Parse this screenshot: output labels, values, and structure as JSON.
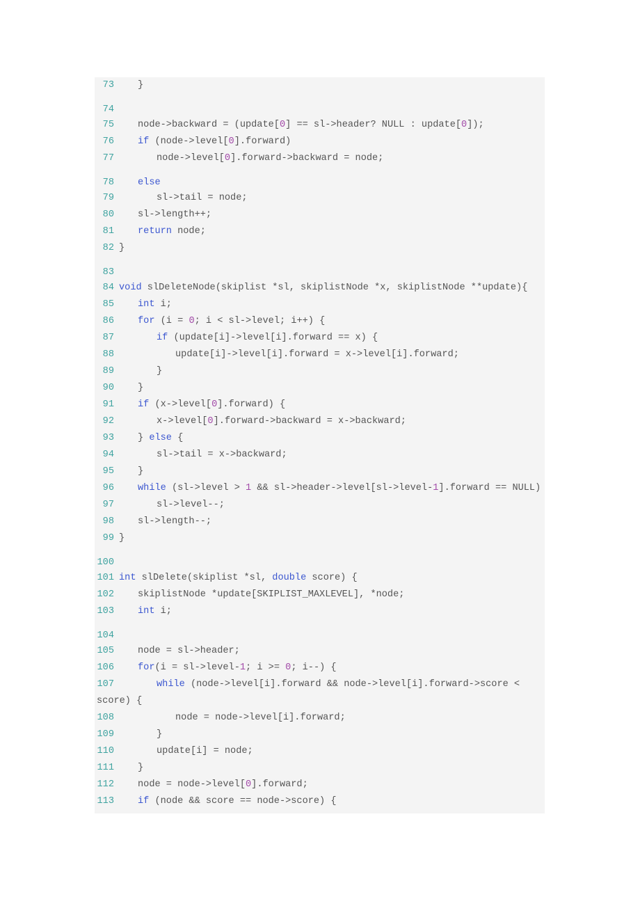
{
  "code_lines": [
    {
      "n": "73",
      "indent": 1,
      "seg": [
        [
          "p",
          "}"
        ]
      ]
    },
    {
      "n": "74",
      "indent": 0,
      "seg": []
    },
    {
      "n": "75",
      "indent": 1,
      "seg": [
        [
          "p",
          "node->backward = (update["
        ],
        [
          "n",
          "0"
        ],
        [
          "p",
          "] == sl->header? NULL : update["
        ],
        [
          "n",
          "0"
        ],
        [
          "p",
          "]);"
        ]
      ]
    },
    {
      "n": "76",
      "indent": 1,
      "seg": [
        [
          "k",
          "if"
        ],
        [
          "p",
          " (node->level["
        ],
        [
          "n",
          "0"
        ],
        [
          "p",
          "].forward)"
        ]
      ]
    },
    {
      "n": "77",
      "indent": 2,
      "seg": [
        [
          "p",
          "node->level["
        ],
        [
          "n",
          "0"
        ],
        [
          "p",
          "].forward->backward = node;"
        ]
      ]
    },
    {
      "n": "78",
      "indent": 1,
      "seg": [
        [
          "k",
          "else"
        ]
      ]
    },
    {
      "n": "79",
      "indent": 2,
      "seg": [
        [
          "p",
          "sl->tail = node;"
        ]
      ]
    },
    {
      "n": "80",
      "indent": 1,
      "seg": [
        [
          "p",
          "sl->length++;"
        ]
      ]
    },
    {
      "n": "81",
      "indent": 1,
      "seg": [
        [
          "k",
          "return"
        ],
        [
          "p",
          " node;"
        ]
      ]
    },
    {
      "n": "82",
      "indent": 0,
      "seg": [
        [
          "p",
          "}"
        ]
      ]
    },
    {
      "n": "83",
      "indent": 0,
      "seg": []
    },
    {
      "n": "84",
      "indent": 0,
      "seg": [
        [
          "k",
          "void"
        ],
        [
          "p",
          " slDeleteNode(skiplist *sl, skiplistNode *x, skiplistNode **update){"
        ]
      ]
    },
    {
      "n": "85",
      "indent": 1,
      "seg": [
        [
          "k",
          "int"
        ],
        [
          "p",
          " i;"
        ]
      ]
    },
    {
      "n": "86",
      "indent": 1,
      "seg": [
        [
          "k",
          "for"
        ],
        [
          "p",
          " (i = "
        ],
        [
          "n",
          "0"
        ],
        [
          "p",
          "; i < sl->level; i++) {"
        ]
      ]
    },
    {
      "n": "87",
      "indent": 2,
      "seg": [
        [
          "k",
          "if"
        ],
        [
          "p",
          " (update[i]->level[i].forward == x) {"
        ]
      ]
    },
    {
      "n": "88",
      "indent": 3,
      "seg": [
        [
          "p",
          "update[i]->level[i].forward = x->level[i].forward;"
        ]
      ]
    },
    {
      "n": "89",
      "indent": 2,
      "seg": [
        [
          "p",
          "}"
        ]
      ]
    },
    {
      "n": "90",
      "indent": 1,
      "seg": [
        [
          "p",
          "}"
        ]
      ]
    },
    {
      "n": "91",
      "indent": 1,
      "seg": [
        [
          "k",
          "if"
        ],
        [
          "p",
          " (x->level["
        ],
        [
          "n",
          "0"
        ],
        [
          "p",
          "].forward) {"
        ]
      ]
    },
    {
      "n": "92",
      "indent": 2,
      "seg": [
        [
          "p",
          "x->level["
        ],
        [
          "n",
          "0"
        ],
        [
          "p",
          "].forward->backward = x->backward;"
        ]
      ]
    },
    {
      "n": "93",
      "indent": 1,
      "seg": [
        [
          "p",
          "} "
        ],
        [
          "k",
          "else"
        ],
        [
          "p",
          " {"
        ]
      ]
    },
    {
      "n": "94",
      "indent": 2,
      "seg": [
        [
          "p",
          "sl->tail = x->backward;"
        ]
      ]
    },
    {
      "n": "95",
      "indent": 1,
      "seg": [
        [
          "p",
          "}"
        ]
      ]
    },
    {
      "n": "96",
      "indent": 1,
      "seg": [
        [
          "k",
          "while"
        ],
        [
          "p",
          " (sl->level > "
        ],
        [
          "n",
          "1"
        ],
        [
          "p",
          " && sl->header->level[sl->level-"
        ],
        [
          "n",
          "1"
        ],
        [
          "p",
          "].forward == NULL)"
        ]
      ]
    },
    {
      "n": "97",
      "indent": 2,
      "seg": [
        [
          "p",
          "sl->level--;"
        ]
      ]
    },
    {
      "n": "98",
      "indent": 1,
      "seg": [
        [
          "p",
          "sl->length--;"
        ]
      ]
    },
    {
      "n": "99",
      "indent": 0,
      "seg": [
        [
          "p",
          "}"
        ]
      ]
    },
    {
      "n": "100",
      "indent": 0,
      "seg": []
    },
    {
      "n": "101",
      "indent": 0,
      "seg": [
        [
          "k",
          "int"
        ],
        [
          "p",
          " slDelete(skiplist *sl, "
        ],
        [
          "k",
          "double"
        ],
        [
          "p",
          " score) {"
        ]
      ]
    },
    {
      "n": "102",
      "indent": 1,
      "seg": [
        [
          "p",
          "skiplistNode *update[SKIPLIST_MAXLEVEL], *node;"
        ]
      ]
    },
    {
      "n": "103",
      "indent": 1,
      "seg": [
        [
          "k",
          "int"
        ],
        [
          "p",
          " i;"
        ]
      ]
    },
    {
      "n": "104",
      "indent": 0,
      "seg": []
    },
    {
      "n": "105",
      "indent": 1,
      "seg": [
        [
          "p",
          "node = sl->header;"
        ]
      ]
    },
    {
      "n": "106",
      "indent": 1,
      "seg": [
        [
          "k",
          "for"
        ],
        [
          "p",
          "(i = sl->level-"
        ],
        [
          "n",
          "1"
        ],
        [
          "p",
          "; i >= "
        ],
        [
          "n",
          "0"
        ],
        [
          "p",
          "; i--) {"
        ]
      ]
    },
    {
      "n": "107",
      "indent": 2,
      "seg": [
        [
          "k",
          "while"
        ],
        [
          "p",
          " (node->level[i].forward && node->level[i].forward->score < score) {"
        ]
      ]
    },
    {
      "n": "108",
      "indent": 3,
      "seg": [
        [
          "p",
          "node = node->level[i].forward;"
        ]
      ]
    },
    {
      "n": "109",
      "indent": 2,
      "seg": [
        [
          "p",
          "}"
        ]
      ]
    },
    {
      "n": "110",
      "indent": 2,
      "seg": [
        [
          "p",
          "update[i] = node;"
        ]
      ]
    },
    {
      "n": "111",
      "indent": 1,
      "seg": [
        [
          "p",
          "}"
        ]
      ]
    },
    {
      "n": "112",
      "indent": 1,
      "seg": [
        [
          "p",
          "node = node->level["
        ],
        [
          "n",
          "0"
        ],
        [
          "p",
          "].forward;"
        ]
      ]
    },
    {
      "n": "113",
      "indent": 1,
      "seg": [
        [
          "k",
          "if"
        ],
        [
          "p",
          " (node && score == node->score) {"
        ]
      ]
    }
  ],
  "colors": {
    "background": "#f4f4f4",
    "line_number": "#3fa3a0",
    "keyword": "#3c57d0",
    "number": "#a24aa8",
    "text": "#555555"
  }
}
